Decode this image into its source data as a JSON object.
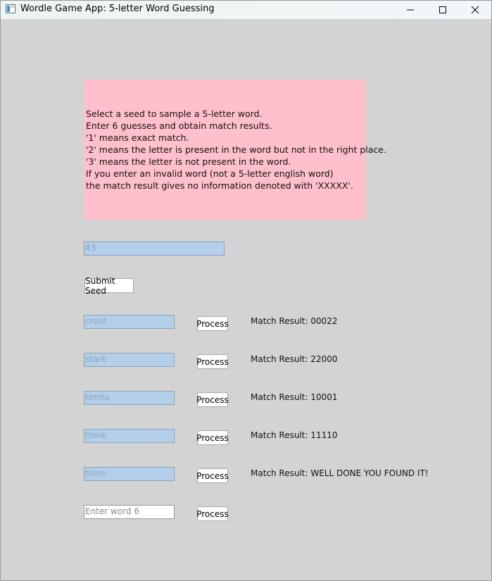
{
  "window": {
    "title": "Wordle Game App: 5-letter Word Guessing"
  },
  "instructions": {
    "lines": [
      "Select a seed to sample a 5-letter word.",
      "Enter 6 guesses and obtain match results.",
      "'1' means exact match.",
      "'2' means the letter is present in the word but not in the right place.",
      "'3' means the letter is not present in the word.",
      "If you enter an invalid word (not a 5-letter english word)",
      "the match result gives no information denoted with 'XXXXX'."
    ],
    "background_color": "#ffc0cb"
  },
  "seed": {
    "value": "43",
    "submit_label": "Submit Seed"
  },
  "guesses": [
    {
      "value": "crust",
      "button_label": "Process",
      "result": "Match Result: 00022"
    },
    {
      "value": "stark",
      "button_label": "Process",
      "result": "Match Result: 22000"
    },
    {
      "value": "terms",
      "button_label": "Process",
      "result": "Match Result: 10001"
    },
    {
      "value": "think",
      "button_label": "Process",
      "result": "Match Result: 11110"
    },
    {
      "value": "thins",
      "button_label": "Process",
      "result": "Match Result: WELL DONE YOU FOUND IT!"
    },
    {
      "placeholder": "Enter word 6",
      "button_label": "Process"
    }
  ],
  "colors": {
    "background": "#d3d3d3",
    "filled_input": "#b4cfe9"
  },
  "icons": [
    "app-icon",
    "minimize-icon",
    "maximize-icon",
    "close-icon"
  ]
}
